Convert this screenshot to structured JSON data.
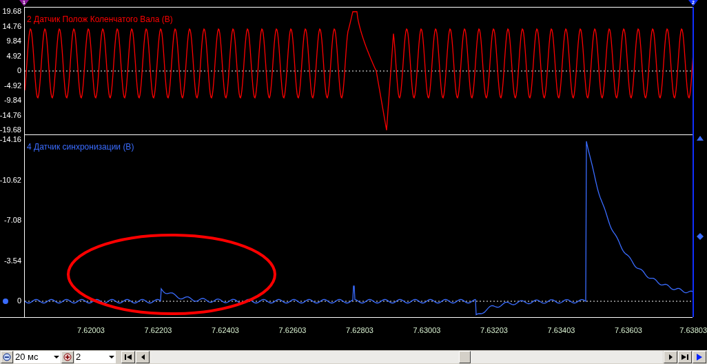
{
  "markers": [
    {
      "label": "1",
      "color": "#8a1a9a"
    },
    {
      "label": "2",
      "color": "#1030ff"
    }
  ],
  "channels": [
    {
      "kind": "crank",
      "title": "2 Датчик Полож Коленчатого Вала (В)",
      "color": "#ff0000",
      "y_ticks": [
        "19.68",
        "14.76",
        "9.84",
        "4.92",
        "0",
        "-4.92",
        "-9.84",
        "-14.76",
        "-19.68"
      ]
    },
    {
      "kind": "sync",
      "title": "4 Датчик синхронизации (В)",
      "color": "#3a6cff",
      "y_ticks": [
        "-14.16",
        "-10.62",
        "-7.08",
        "-3.54",
        "0"
      ]
    }
  ],
  "x_ticks": [
    "7.62003",
    "7.62203",
    "7.62403",
    "7.62603",
    "7.62803",
    "7.63003",
    "7.63203",
    "7.63403",
    "7.63603",
    "7.63803"
  ],
  "toolbar": {
    "timebase": "20 мс",
    "zoom": "2"
  }
}
